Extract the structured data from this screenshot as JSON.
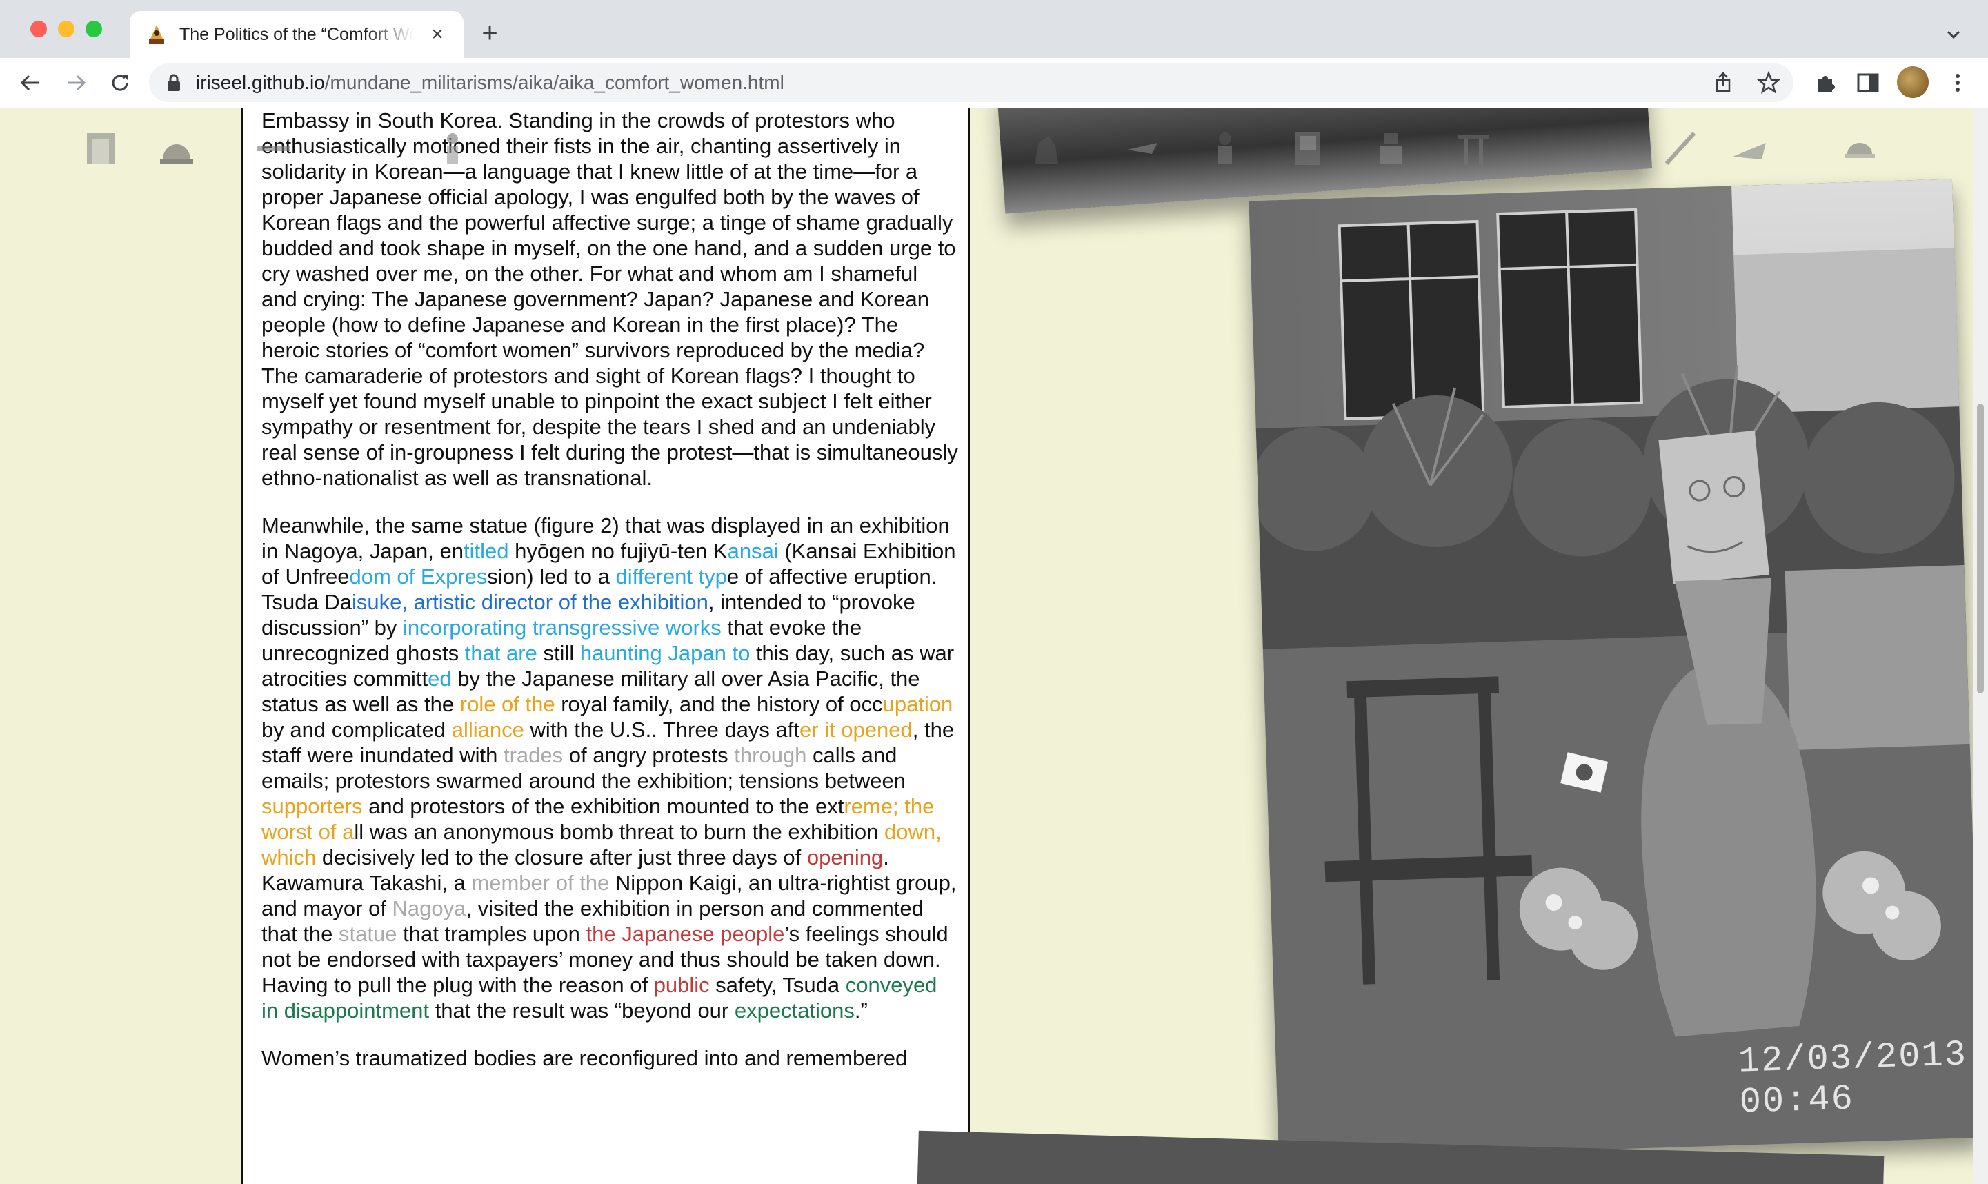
{
  "browser": {
    "tab_title": "The Politics of the “Comfort Women” Statue",
    "url_domain": "iriseel.github.io",
    "url_path": "/mundane_militarisms/aika/aika_comfort_women.html",
    "tab_close": "×",
    "new_tab": "+"
  },
  "article": {
    "paragraphs": [
      {
        "segments": [
          {
            "text": "protest calling for justices for “comfort women” in front of the Japanese Embassy in South Korea. Standing in the crowds of protestors who enthusiastically motioned their fists in the air, chanting assertively in solidarity in Korean—a language that I knew little of at the time—for a proper Japanese official apology, I was engulfed both by the waves of Korean flags and the powerful affective surge; a tinge of shame gradually budded and took shape in myself, on the one hand, and a sudden urge to cry washed over me, on the other. For what and whom am I shameful and crying: The Japanese government? Japan? Japanese and Korean people (how to define Japanese and Korean in the first place)? The heroic stories of “comfort women” survivors reproduced by the media? The camaraderie of protestors and sight of Korean flags? I thought to myself yet found myself unable to pinpoint the exact subject I felt either sympathy or resentment for, despite the tears I shed and an undeniably real sense of in-groupness I felt during the protest—that is simultaneously ethno-nationalist as well as transnational.",
            "color": ""
          }
        ]
      },
      {
        "segments": [
          {
            "text": "Meanwhile, the same statue (figure 2) that was displayed in an exhibition in Nagoya, Japan, en",
            "color": ""
          },
          {
            "text": "titled",
            "color": "c1"
          },
          {
            "text": " hyōgen no fujiyū-ten K",
            "color": ""
          },
          {
            "text": "ansai",
            "color": "c1"
          },
          {
            "text": " (Kansai Exhibition of Unfree",
            "color": ""
          },
          {
            "text": "dom of Expres",
            "color": "c1"
          },
          {
            "text": "sion) led to a ",
            "color": ""
          },
          {
            "text": "different typ",
            "color": "c1"
          },
          {
            "text": "e of affective eruption. Tsuda Da",
            "color": ""
          },
          {
            "text": "isuke, artistic director of the exhibition",
            "color": "c2"
          },
          {
            "text": ", intended to “provoke discussion” by ",
            "color": ""
          },
          {
            "text": "incorporating transgressive works",
            "color": "c1"
          },
          {
            "text": " that evoke the unrecognized ghosts ",
            "color": ""
          },
          {
            "text": "that are",
            "color": "c1"
          },
          {
            "text": " still ",
            "color": ""
          },
          {
            "text": "haunting Japan to",
            "color": "c1"
          },
          {
            "text": " this day, such as war atrocities committ",
            "color": ""
          },
          {
            "text": "ed",
            "color": "c1"
          },
          {
            "text": " by the Japanese military all over Asia Pacific, the status as well as the ",
            "color": ""
          },
          {
            "text": "role of the",
            "color": "c3"
          },
          {
            "text": " royal family, and the history of occ",
            "color": ""
          },
          {
            "text": "upation",
            "color": "c3"
          },
          {
            "text": " by and complicated ",
            "color": ""
          },
          {
            "text": "alliance",
            "color": "c3"
          },
          {
            "text": " with the U.S.. Three days aft",
            "color": ""
          },
          {
            "text": "er it opened",
            "color": "c3"
          },
          {
            "text": ", the staff were inundated with ",
            "color": ""
          },
          {
            "text": "trades",
            "color": "c5"
          },
          {
            "text": " of angry protests ",
            "color": ""
          },
          {
            "text": "through",
            "color": "c5"
          },
          {
            "text": " calls and emails; protestors swarmed around the exhibition; tensions between ",
            "color": ""
          },
          {
            "text": "supporters",
            "color": "c3"
          },
          {
            "text": " and protestors of the exhibition mounted to the ext",
            "color": ""
          },
          {
            "text": "reme; the worst of a",
            "color": "c3"
          },
          {
            "text": "ll was an anonymous bomb threat to burn the exhibition ",
            "color": ""
          },
          {
            "text": "down, which",
            "color": "c3"
          },
          {
            "text": " decisively led to the closure after just three days of ",
            "color": ""
          },
          {
            "text": "opening",
            "color": "c4"
          },
          {
            "text": ". Kawamura Takashi, a ",
            "color": ""
          },
          {
            "text": "member of the",
            "color": "c5"
          },
          {
            "text": " Nippon Kaigi, an ultra-rightist group, and mayor of ",
            "color": ""
          },
          {
            "text": "Nagoya",
            "color": "c5"
          },
          {
            "text": ", visited the exhibition in person and commented that the ",
            "color": ""
          },
          {
            "text": "statue",
            "color": "c5"
          },
          {
            "text": " that tramples upon ",
            "color": ""
          },
          {
            "text": "the Japanese people",
            "color": "c4"
          },
          {
            "text": "’s feelings should not be endorsed with taxpayers’ money and thus should be taken down. Having to pull the plug with the reason of ",
            "color": ""
          },
          {
            "text": "public",
            "color": "c4"
          },
          {
            "text": " safety, Tsuda ",
            "color": ""
          },
          {
            "text": "conveyed in disappointment",
            "color": "c7"
          },
          {
            "text": " that the result was “beyond our ",
            "color": ""
          },
          {
            "text": "expectations",
            "color": "c7"
          },
          {
            "text": ".”",
            "color": ""
          }
        ]
      },
      {
        "segments": [
          {
            "text": "Women’s traumatized bodies are reconfigured into and remembered",
            "color": ""
          }
        ]
      }
    ]
  },
  "photo": {
    "timestamp": "12/03/2013 00:46"
  },
  "colors": {
    "page_background": "#f1f2d6",
    "article_background": "#ffffff",
    "accent_blue": "#27a9e1",
    "accent_yellow": "#e9a219",
    "accent_red": "#c23a3a",
    "accent_green": "#1b7a4c"
  },
  "icons": [
    "back-icon",
    "forward-icon",
    "reload-icon",
    "lock-icon",
    "share-icon",
    "bookmark-star-icon",
    "extensions-icon",
    "side-panel-icon",
    "menu-icon",
    "tab-search-icon"
  ]
}
